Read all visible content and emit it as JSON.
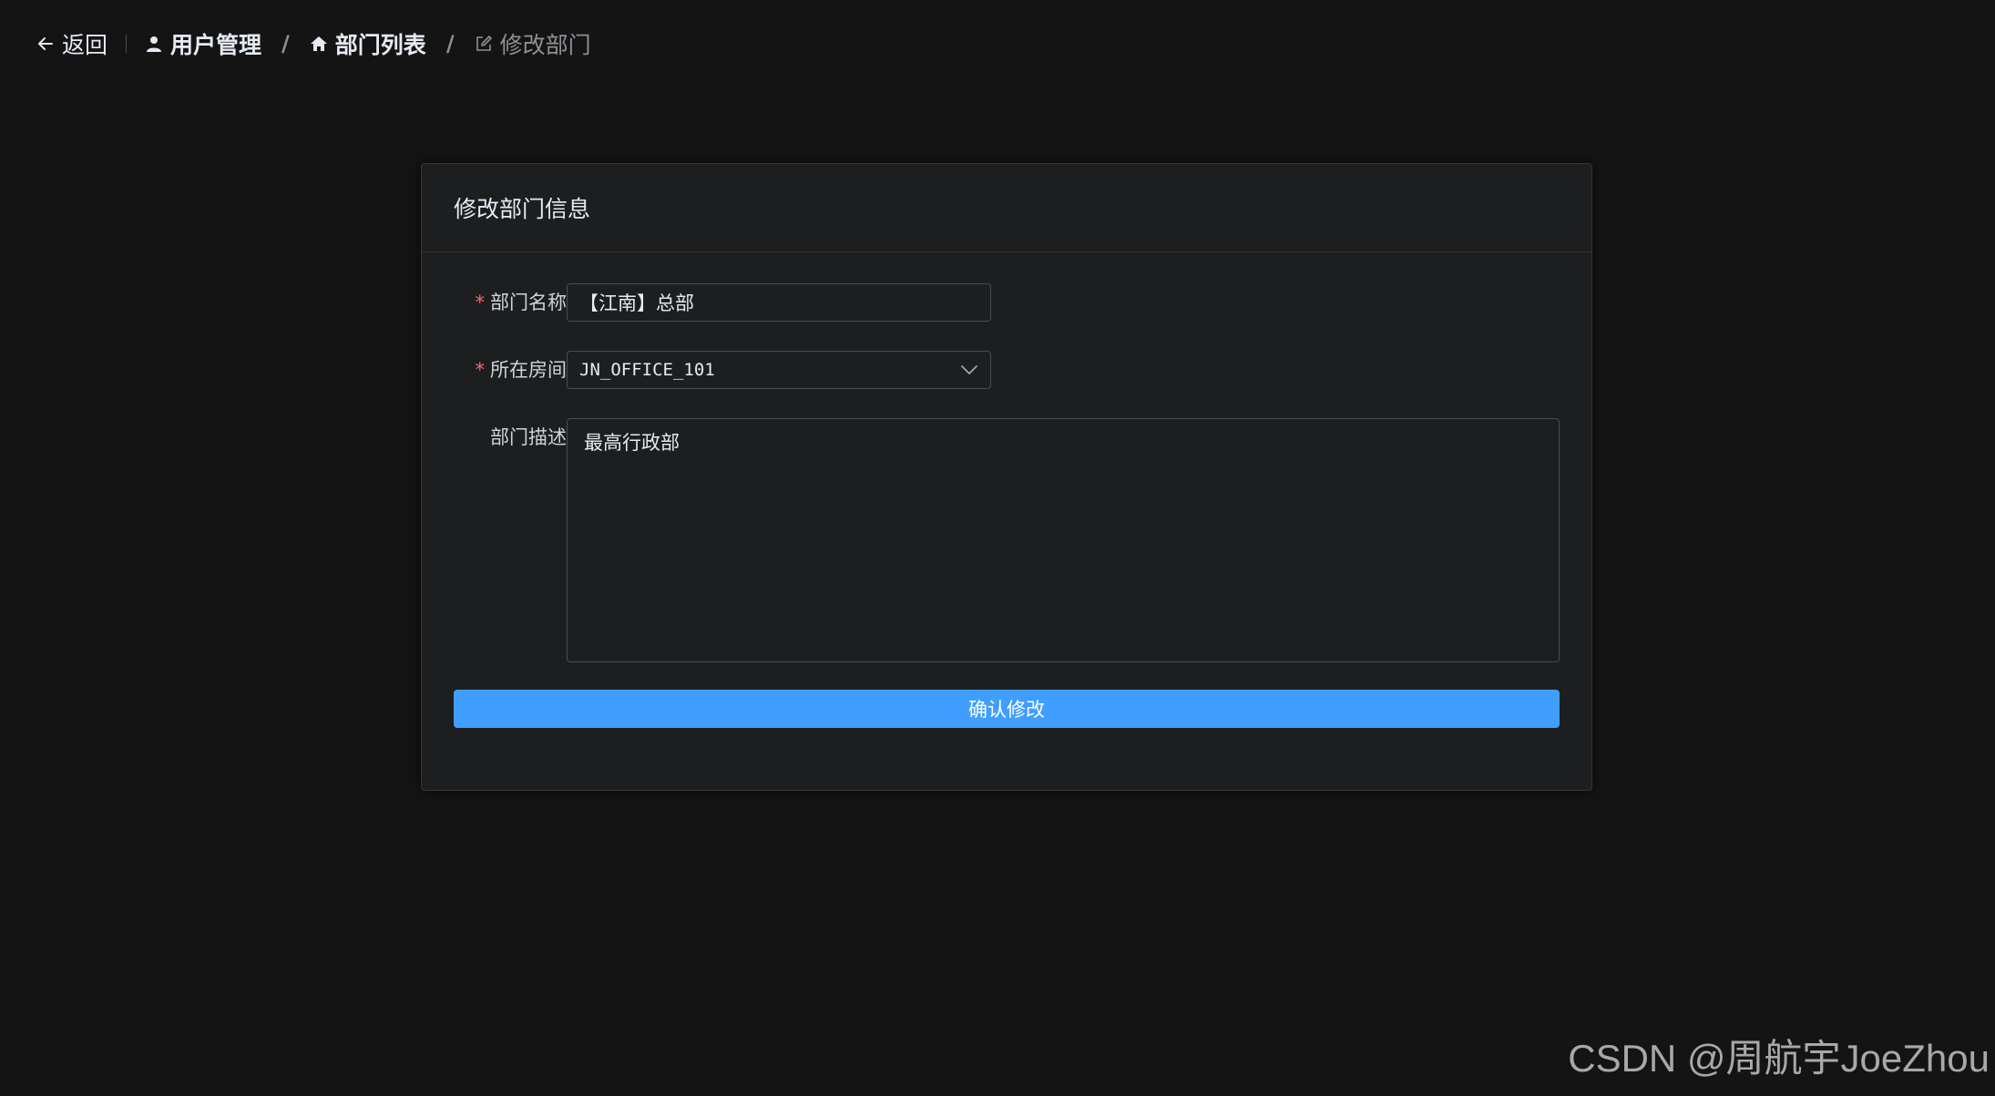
{
  "header": {
    "back_label": "返回",
    "breadcrumb": [
      {
        "label": "用户管理",
        "icon": "user-icon"
      },
      {
        "label": "部门列表",
        "icon": "home-icon"
      },
      {
        "label": "修改部门",
        "icon": "edit-icon"
      }
    ],
    "separator": "/"
  },
  "card": {
    "title": "修改部门信息",
    "fields": {
      "name": {
        "label": "部门名称",
        "required_mark": "*",
        "value": "【江南】总部"
      },
      "room": {
        "label": "所在房间",
        "required_mark": "*",
        "value": "JN_OFFICE_101"
      },
      "description": {
        "label": "部门描述",
        "value": "最高行政部"
      }
    },
    "submit_label": "确认修改"
  },
  "watermark": "CSDN @周航宇JoeZhou",
  "colors": {
    "background": "#141414",
    "card": "#1d1e1f",
    "primary": "#409eff",
    "required": "#f56c6c"
  }
}
